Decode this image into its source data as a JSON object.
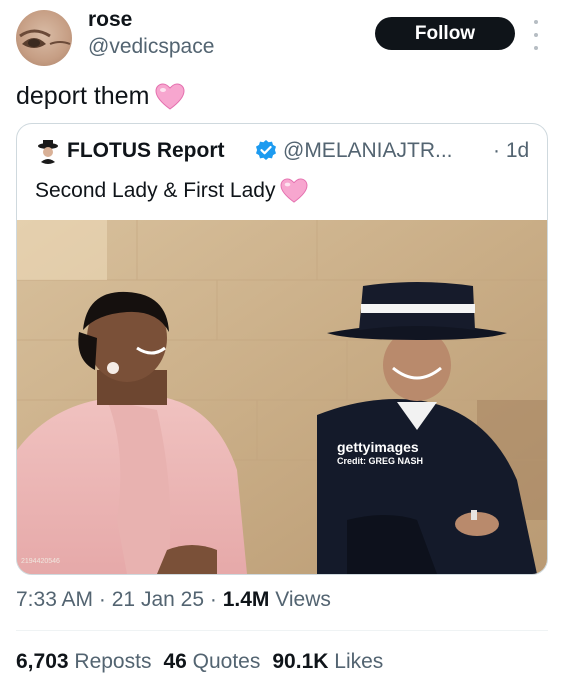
{
  "author": {
    "name": "rose",
    "handle": "@vedicspace",
    "follow_label": "Follow"
  },
  "tweet": {
    "text": "deport them",
    "emoji": "pink-heart-emoji"
  },
  "quoted": {
    "name": "FLOTUS Report",
    "handle": "@MELANIAJTR...",
    "time": "· 1d",
    "text": "Second Lady & First Lady",
    "emoji": "pink-heart-emoji"
  },
  "photo": {
    "watermark_brand": "gettyimages",
    "watermark_credit": "Credit: GREG NASH",
    "image_id": "2194420546"
  },
  "meta": {
    "time": "7:33 AM",
    "date": "21 Jan 25",
    "views_count": "1.4M",
    "views_label": "Views",
    "sep": "·"
  },
  "stats": {
    "reposts_count": "6,703",
    "reposts_label": "Reposts",
    "quotes_count": "46",
    "quotes_label": "Quotes",
    "likes_count": "90.1K",
    "likes_label": "Likes"
  },
  "colors": {
    "text_primary": "#0f1419",
    "text_secondary": "#536471",
    "verified": "#1d9bf0",
    "heart": "#f78fc4"
  }
}
